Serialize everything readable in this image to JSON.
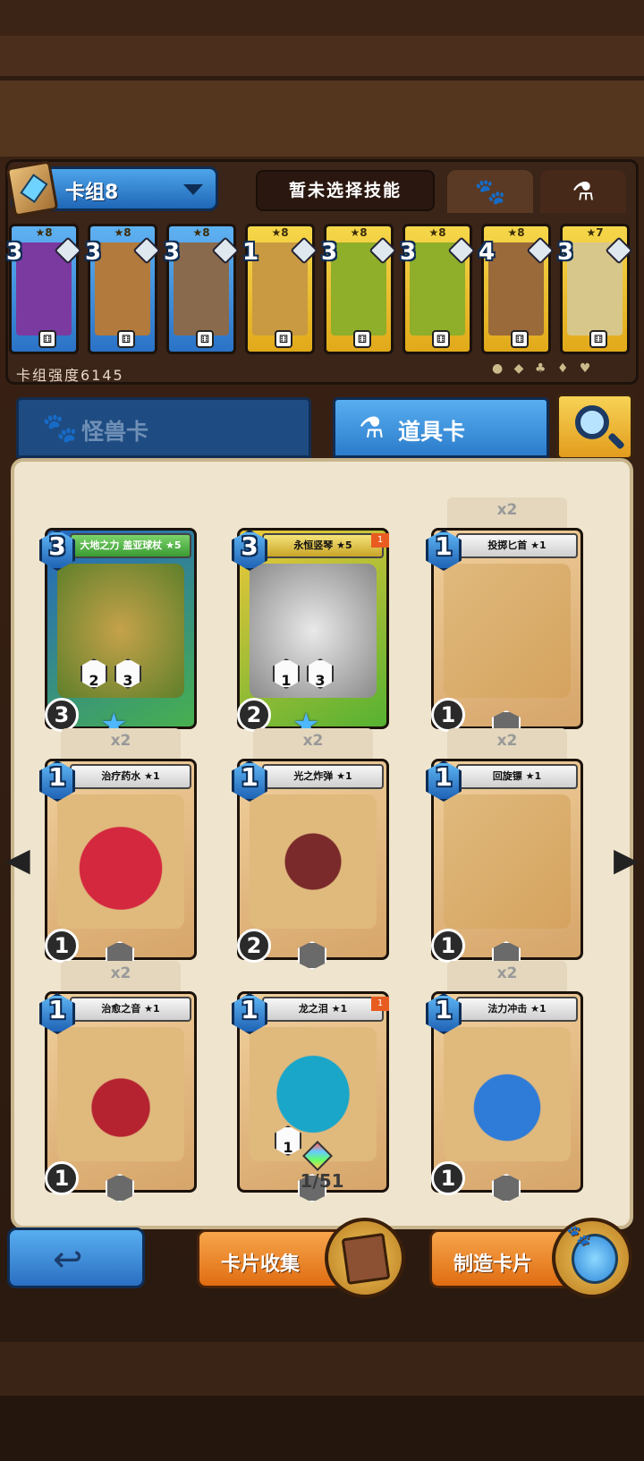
{
  "deck": {
    "selector_label": "卡组8",
    "skill_label": "暂未选择技能",
    "strength_label": "卡组强度6145",
    "cards": [
      {
        "stars": "★8",
        "cost": "3",
        "theme": "blue",
        "art": "#7a3aa0"
      },
      {
        "stars": "★8",
        "cost": "3",
        "theme": "blue",
        "art": "#b27a3c"
      },
      {
        "stars": "★8",
        "cost": "3",
        "theme": "blue",
        "art": "#8a6a4c"
      },
      {
        "stars": "★8",
        "cost": "1",
        "theme": "gold",
        "art": "#c99a42"
      },
      {
        "stars": "★8",
        "cost": "3",
        "theme": "gold",
        "art": "#8fae2a"
      },
      {
        "stars": "★8",
        "cost": "3",
        "theme": "gold",
        "art": "#8fae2a"
      },
      {
        "stars": "★8",
        "cost": "4",
        "theme": "gold",
        "art": "#9a6a3a"
      },
      {
        "stars": "★7",
        "cost": "3",
        "theme": "gold",
        "art": "#d8c78a"
      }
    ]
  },
  "tabs": {
    "monster": "怪兽卡",
    "item": "道具卡"
  },
  "cards": [
    {
      "name": "大地之力 盖亚球杖 ★5",
      "cost": "3",
      "power": "3",
      "count": "",
      "legend": true,
      "art": "radial-gradient(#c5a24a,#5f7f2a)",
      "sub1": "2",
      "sub2": "3"
    },
    {
      "name": "永恒竖琴 ★5",
      "cost": "3",
      "power": "2",
      "count": "",
      "legend": true,
      "art": "radial-gradient(#e9e9e9,#8a8a8a)",
      "sub1": "1",
      "sub2": "3",
      "flag": "1"
    },
    {
      "name": "投掷匕首 ★1",
      "cost": "1",
      "power": "1",
      "count": "x2",
      "legend": false,
      "art": "linear-gradient(135deg,#e0b97d,#d5a35e)"
    },
    {
      "name": "治疗药水 ★1",
      "cost": "1",
      "power": "1",
      "count": "x2",
      "legend": false,
      "art": "radial-gradient(circle at 50% 55%,#d4283f 0 42%,#e0b97d 43%)"
    },
    {
      "name": "光之炸弹 ★1",
      "cost": "1",
      "power": "2",
      "count": "x2",
      "legend": false,
      "art": "radial-gradient(circle at 50% 50%,#7a2a2a 0 30%,#e0b97d 31%)"
    },
    {
      "name": "回旋镖 ★1",
      "cost": "1",
      "power": "1",
      "count": "x2",
      "legend": false,
      "art": "linear-gradient(135deg,#e0b97d,#d5a35e)"
    },
    {
      "name": "治愈之音 ★1",
      "cost": "1",
      "power": "1",
      "count": "x2",
      "legend": false,
      "art": "radial-gradient(circle at 50% 60%,#b52331 0 28%,#e0b97d 29%)"
    },
    {
      "name": "龙之泪 ★1",
      "cost": "1",
      "power": "",
      "count": "",
      "legend": false,
      "art": "radial-gradient(ellipse at 50% 50%,#1aa6c9 0 40%,#e0b97d 41%)",
      "flag": "1",
      "sub1": "1"
    },
    {
      "name": "法力冲击 ★1",
      "cost": "1",
      "power": "1",
      "count": "x2",
      "legend": false,
      "art": "radial-gradient(circle at 50% 60%,#2f7bd8 0 32%,#e0b97d 33%)"
    }
  ],
  "egg_counter": "1/51",
  "buttons": {
    "back": "↩",
    "collect": "卡片收集",
    "craft": "制造卡片"
  },
  "nav": {
    "left": "◀",
    "right": "▶"
  }
}
